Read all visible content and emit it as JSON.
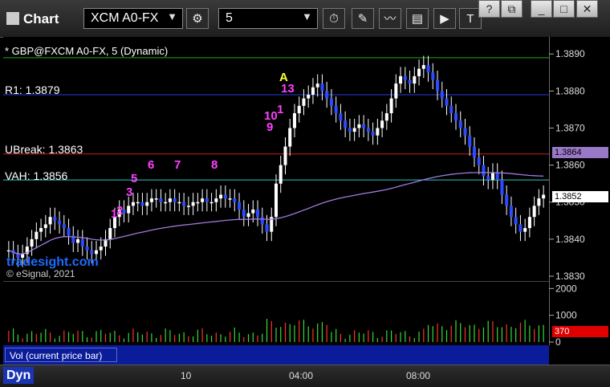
{
  "app": {
    "title": "Chart",
    "symbol": "XCM A0-FX",
    "interval": "5"
  },
  "header": {
    "symbol_line": "* GBP@FXCM A0-FX, 5 (Dynamic)"
  },
  "levels": [
    {
      "label": "R1: 1.3879",
      "value": 1.3879,
      "color": "#2a3dd9"
    },
    {
      "label": "UBreak: 1.3863",
      "value": 1.3863,
      "color": "#d01818"
    },
    {
      "label": "VAH: 1.3856",
      "value": 1.3856,
      "color": "#26c9c9"
    }
  ],
  "watermark": "tradesight.com",
  "copyright": "© eSignal, 2021",
  "vol_label": "Vol (current price bar)",
  "bottom": {
    "tab": "Dyn"
  },
  "price_tags": {
    "vwap": "1.3864",
    "last": "1.3852",
    "vol": "370"
  },
  "seq_numbers": [
    "1",
    "2",
    "3",
    "5",
    "6",
    "7",
    "8",
    "9",
    "10",
    "1",
    "13",
    "A"
  ],
  "chart_data": {
    "type": "candlestick",
    "y_ticks": [
      "1.3890",
      "1.3880",
      "1.3870",
      "1.3860",
      "1.3850",
      "1.3840",
      "1.3830"
    ],
    "ylim": [
      1.383,
      1.3892
    ],
    "x_ticks": [
      "10",
      "04:00",
      "08:00"
    ],
    "vol_ticks": [
      "2000",
      "1000",
      "0"
    ],
    "vol_ylim": [
      0,
      2100
    ],
    "close": [
      1.3837,
      1.3836,
      1.3835,
      1.3836,
      1.3838,
      1.384,
      1.3842,
      1.3843,
      1.3844,
      1.3846,
      1.3845,
      1.3844,
      1.3843,
      1.3841,
      1.3839,
      1.384,
      1.3838,
      1.3837,
      1.3836,
      1.3837,
      1.3838,
      1.384,
      1.3843,
      1.3846,
      1.3848,
      1.3847,
      1.3849,
      1.385,
      1.385,
      1.3849,
      1.385,
      1.3851,
      1.3851,
      1.385,
      1.385,
      1.3851,
      1.385,
      1.385,
      1.3849,
      1.3849,
      1.385,
      1.385,
      1.3851,
      1.385,
      1.385,
      1.3851,
      1.3852,
      1.3851,
      1.3851,
      1.385,
      1.3848,
      1.3846,
      1.3847,
      1.3848,
      1.3846,
      1.3844,
      1.3842,
      1.3846,
      1.3855,
      1.386,
      1.3865,
      1.387,
      1.3874,
      1.3876,
      1.3878,
      1.3879,
      1.3881,
      1.3882,
      1.388,
      1.3878,
      1.3876,
      1.3874,
      1.3872,
      1.387,
      1.3869,
      1.387,
      1.3871,
      1.387,
      1.3869,
      1.3868,
      1.387,
      1.3872,
      1.3874,
      1.3878,
      1.3882,
      1.3884,
      1.3883,
      1.3882,
      1.3884,
      1.3886,
      1.3887,
      1.3885,
      1.3883,
      1.388,
      1.3878,
      1.3876,
      1.3874,
      1.3872,
      1.387,
      1.3868,
      1.3865,
      1.3862,
      1.386,
      1.3857,
      1.3856,
      1.3858,
      1.3856,
      1.3852,
      1.3849,
      1.3846,
      1.3844,
      1.3842,
      1.3843,
      1.3846,
      1.3849,
      1.3851,
      1.3852
    ]
  }
}
